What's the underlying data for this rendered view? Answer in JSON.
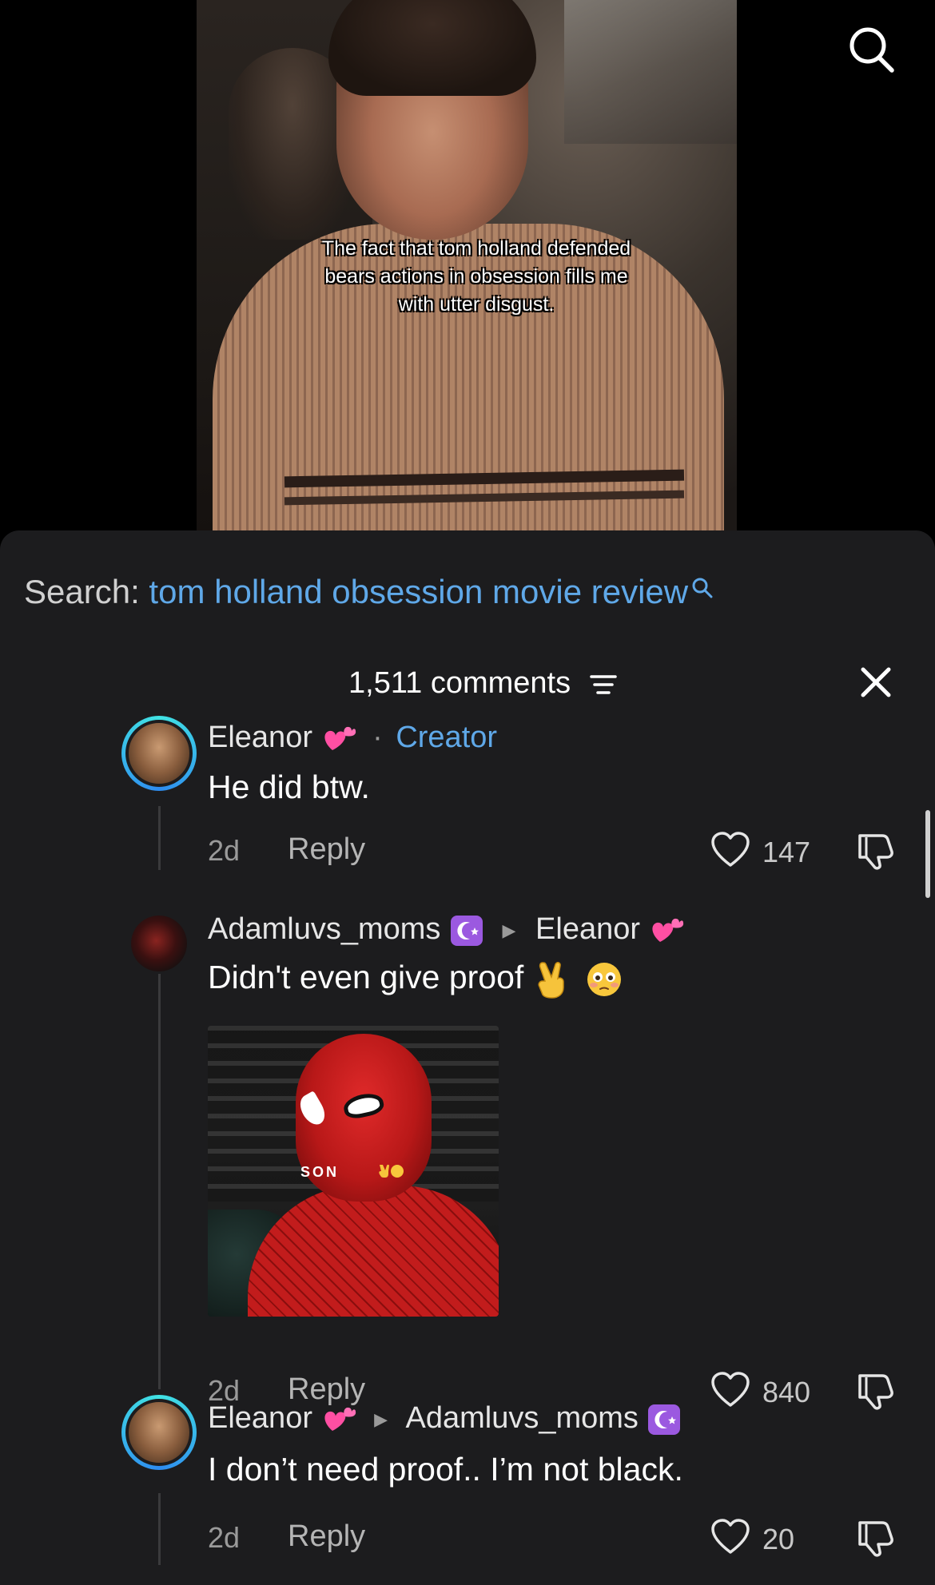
{
  "video": {
    "caption": "The fact that tom holland defended bears actions in obsession fills me with utter disgust."
  },
  "search_suggestion": {
    "prefix": "Search:",
    "term": "tom holland obsession movie review"
  },
  "comments_header": {
    "count_label": "1,511 comments"
  },
  "comments": [
    {
      "author": "Eleanor",
      "author_emoji": "heart-icon",
      "creator_label": "Creator",
      "text": "He did btw.",
      "time": "2d",
      "reply_label": "Reply",
      "likes": "147"
    },
    {
      "author": "Adamluvs_moms",
      "reply_to": "Eleanor",
      "text": "Didn't even give proof",
      "gif_caption": "SON",
      "time": "2d",
      "reply_label": "Reply",
      "likes": "840"
    },
    {
      "author": "Eleanor",
      "reply_to": "Adamluvs_moms",
      "text": "I don’t need proof.. I’m not black.",
      "time": "2d",
      "reply_label": "Reply",
      "likes": "20"
    }
  ],
  "colors": {
    "sheet_bg": "#1c1c1e",
    "link_blue": "#5fa8e8",
    "badge_purple": "#9b59e0",
    "heart_pink": "#ff4fa3"
  }
}
